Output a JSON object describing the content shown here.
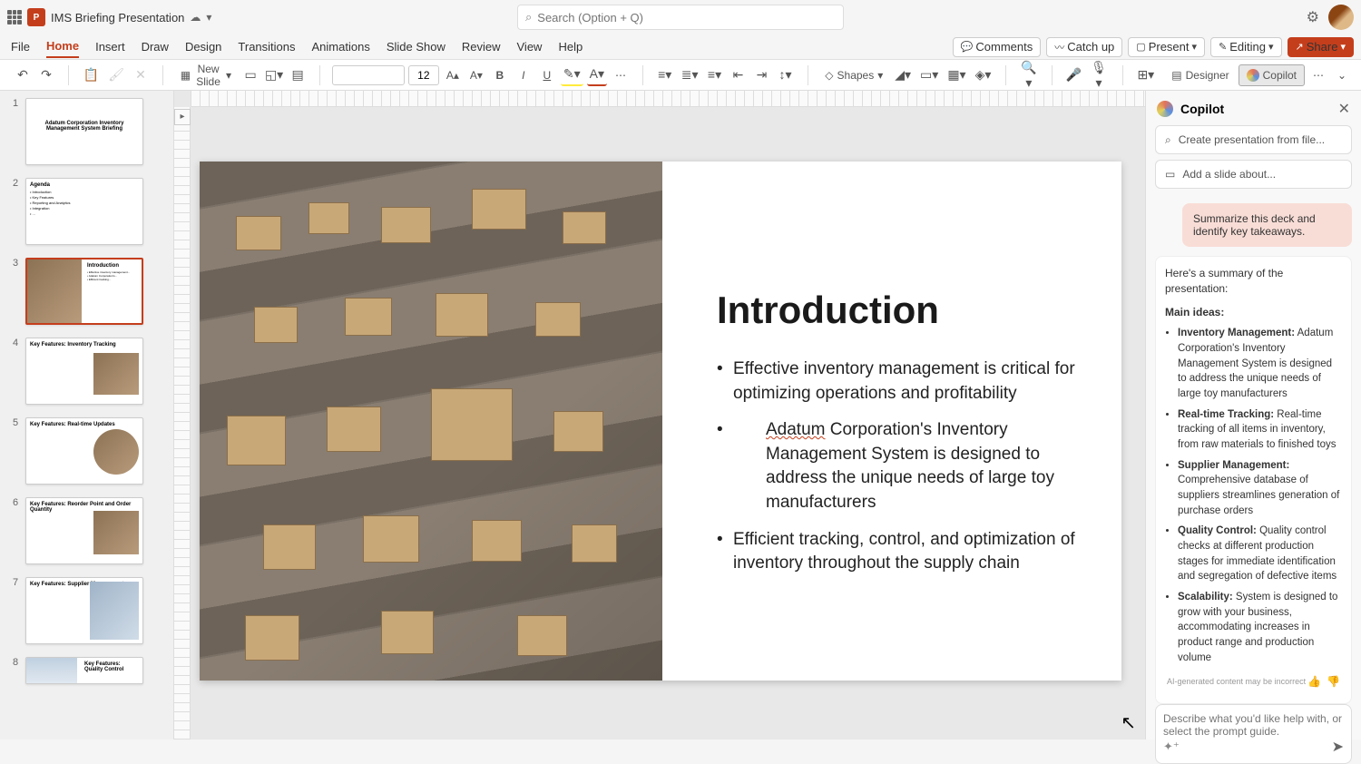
{
  "title": "IMS Briefing Presentation",
  "search_placeholder": "Search (Option + Q)",
  "menus": [
    "File",
    "Home",
    "Insert",
    "Draw",
    "Design",
    "Transitions",
    "Animations",
    "Slide Show",
    "Review",
    "View",
    "Help"
  ],
  "menu_right": {
    "comments": "Comments",
    "catchup": "Catch up",
    "present": "Present",
    "editing": "Editing",
    "share": "Share"
  },
  "ribbon": {
    "new_slide": "New Slide",
    "font_size": "12",
    "shapes": "Shapes",
    "designer": "Designer",
    "copilot": "Copilot"
  },
  "thumbs": [
    {
      "n": "1",
      "title": "Adatum Corporation\nInventory Management\nSystem Briefing"
    },
    {
      "n": "2",
      "title": "Agenda"
    },
    {
      "n": "3",
      "title": "Introduction",
      "selected": true,
      "img_left": true
    },
    {
      "n": "4",
      "title": "Key Features:\nInventory Tracking",
      "img_right": true
    },
    {
      "n": "5",
      "title": "Key Features:\nReal-time Updates",
      "img_right": true
    },
    {
      "n": "6",
      "title": "Key Features:\nReorder Point and\nOrder Quantity",
      "img_right": true
    },
    {
      "n": "7",
      "title": "Key Features:\nSupplier\nManagement",
      "img_right": true
    },
    {
      "n": "8",
      "title": "Key Features:\nQuality Control",
      "img_right": true
    }
  ],
  "slide": {
    "heading": "Introduction",
    "b1": "Effective inventory management is critical for optimizing operations and profitability",
    "b2a": "Adatum",
    "b2b": " Corporation's Inventory Management System is designed to address the unique needs of large toy manufacturers",
    "b3": "Efficient tracking, control, and optimization of inventory throughout the supply chain"
  },
  "copilot": {
    "title": "Copilot",
    "action1": "Create presentation from file...",
    "action2": "Add a slide about...",
    "user": "Summarize this deck and identify key takeaways.",
    "intro": "Here's a summary of the presentation:",
    "heading": "Main ideas:",
    "items": [
      {
        "b": "Inventory Management:",
        "t": " Adatum Corporation's Inventory Management System is designed to address the unique needs of large toy manufacturers"
      },
      {
        "b": "Real-time Tracking:",
        "t": " Real-time tracking of all items in inventory, from raw materials to finished toys"
      },
      {
        "b": "Supplier Management:",
        "t": " Comprehensive database of suppliers streamlines generation of purchase orders"
      },
      {
        "b": "Quality Control:",
        "t": " Quality control checks at different production stages for immediate identification and segregation of defective items"
      },
      {
        "b": "Scalability:",
        "t": " System is designed to grow with your business, accommodating increases in product range and production volume"
      }
    ],
    "disclaimer": "AI-generated content may be incorrect",
    "input_placeholder": "Describe what you'd like help with, or select the prompt guide."
  }
}
